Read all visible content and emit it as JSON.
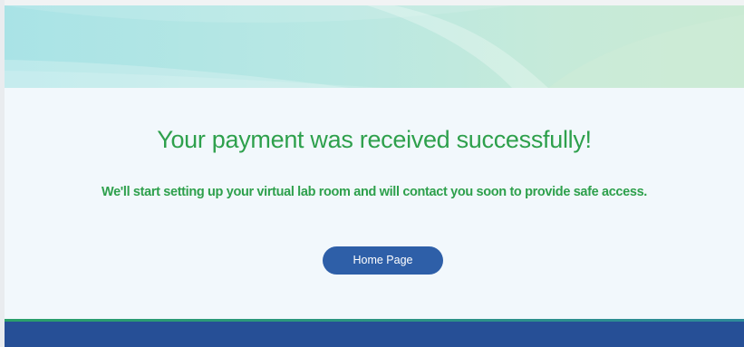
{
  "confirmation": {
    "title": "Your payment was received successfully!",
    "message": "We'll start setting up your virtual lab room and will contact you soon to provide safe access.",
    "home_button_label": "Home Page"
  },
  "colors": {
    "text_accent": "#2ea04c",
    "button": "#2e5fa8",
    "footer": "#264f96",
    "content_background": "#f2f8fc"
  }
}
